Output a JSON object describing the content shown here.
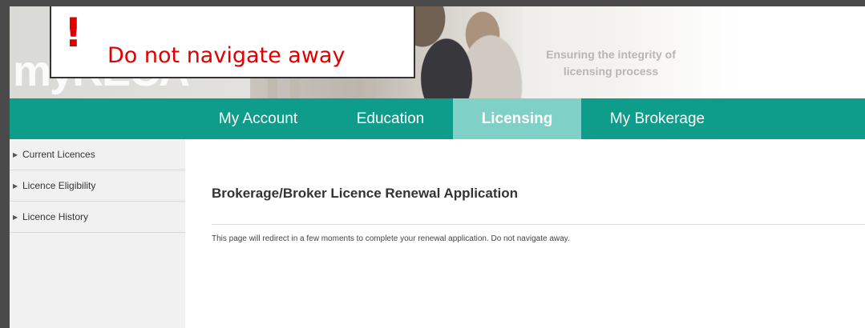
{
  "warning": {
    "mark": "!",
    "text": "Do not navigate away"
  },
  "banner": {
    "logo_text": "myRECA",
    "tagline_line1": "Ensuring the integrity of",
    "tagline_line2": "licensing process"
  },
  "nav": {
    "items": [
      {
        "label": "My Account",
        "active": false
      },
      {
        "label": "Education",
        "active": false
      },
      {
        "label": "Licensing",
        "active": true
      },
      {
        "label": "My Brokerage",
        "active": false
      }
    ]
  },
  "sidebar": {
    "items": [
      {
        "label": "Current Licences"
      },
      {
        "label": "Licence Eligibility"
      },
      {
        "label": "Licence History"
      }
    ]
  },
  "main": {
    "title": "Brokerage/Broker Licence Renewal Application",
    "message": "This page will redirect in a few moments to complete your renewal application. Do not navigate away."
  },
  "colors": {
    "accent": "#0e9c8b",
    "active_tab": "#7fd0c7",
    "warning": "#e00000"
  }
}
